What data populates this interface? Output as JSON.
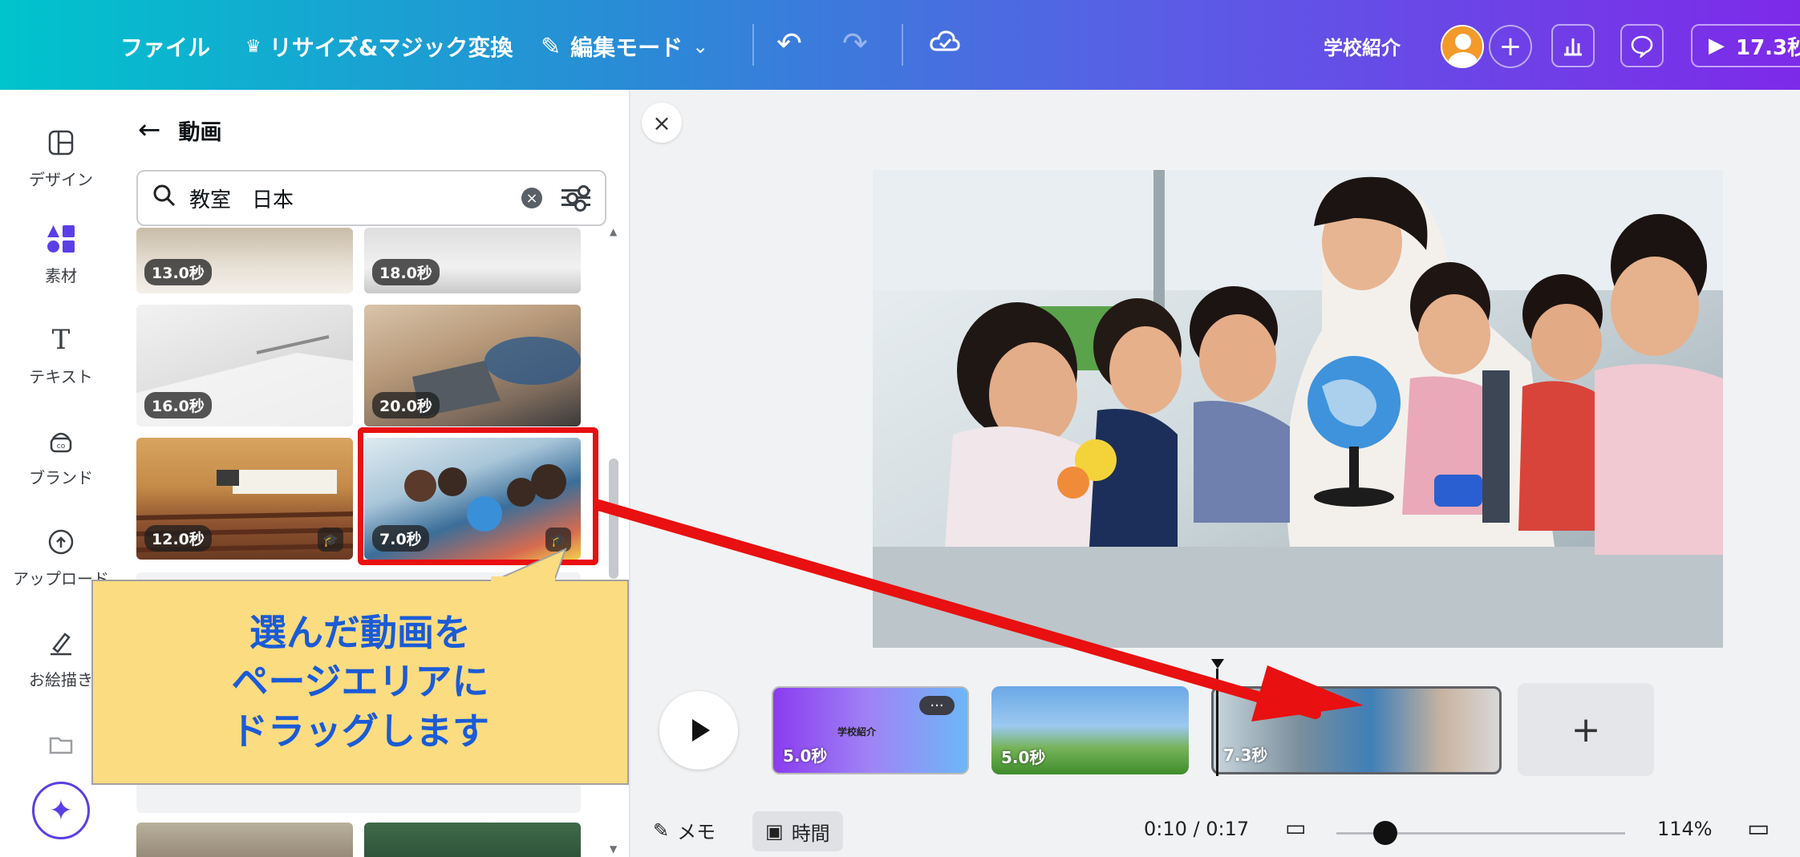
{
  "topbar": {
    "file": "ファイル",
    "resize": "リサイズ&マジック変換",
    "edit_mode": "編集モード",
    "doc_title": "学校紹介",
    "present_duration": "17.3秒"
  },
  "rail": {
    "design": "デザイン",
    "elements": "素材",
    "text": "テキスト",
    "brand": "ブランド",
    "uploads": "アップロード",
    "draw": "お絵描き"
  },
  "panel": {
    "title": "動画",
    "search_query": "教室　日本"
  },
  "results": [
    {
      "duration": "13.0秒",
      "pro": false
    },
    {
      "duration": "18.0秒",
      "pro": false
    },
    {
      "duration": "16.0秒",
      "pro": false
    },
    {
      "duration": "20.0秒",
      "pro": false
    },
    {
      "duration": "12.0秒",
      "pro": true
    },
    {
      "duration": "7.0秒",
      "pro": true
    }
  ],
  "callout": {
    "line1": "選んだ動画を",
    "line2": "ページエリアに",
    "line3": "ドラッグします"
  },
  "timeline": {
    "clips": [
      {
        "duration": "5.0秒",
        "title": "学校紹介"
      },
      {
        "duration": "5.0秒"
      },
      {
        "duration": "7.3秒"
      }
    ]
  },
  "bottombar": {
    "notes": "メモ",
    "time_label": "時間",
    "timecode": "0:10 / 0:17",
    "zoom": "114%",
    "zoom_level": 0.17
  },
  "colors": {
    "highlight": "#e81010",
    "callout_bg": "#fbdc80",
    "callout_text": "#1a5bd6",
    "accent": "#7d2ae8"
  }
}
